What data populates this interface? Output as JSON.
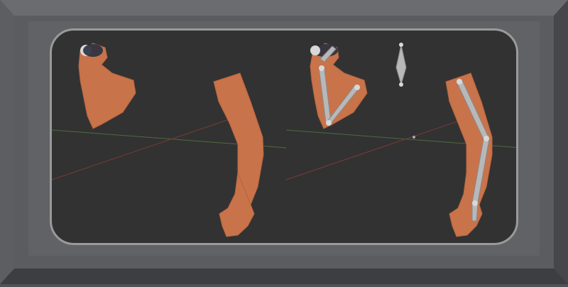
{
  "scene": {
    "description_hidden": "",
    "colors": {
      "background": "#323232",
      "bezel": "#5a5c60",
      "skin": "#c9734a",
      "bone": "#b8b8b8",
      "bone_dark": "#8a8a8a",
      "x_axis": "#7a3a3a",
      "y_axis": "#4a6a3a"
    },
    "objects": [
      {
        "name": "flexed-arm-mesh",
        "icon": "arm-mesh-icon"
      },
      {
        "name": "straight-arm-mesh",
        "icon": "arm-mesh-icon"
      },
      {
        "name": "flexed-arm-armature",
        "icon": "armature-bones-icon"
      },
      {
        "name": "straight-arm-armature",
        "icon": "armature-bones-icon"
      },
      {
        "name": "single-bone",
        "icon": "bone-icon"
      }
    ]
  }
}
